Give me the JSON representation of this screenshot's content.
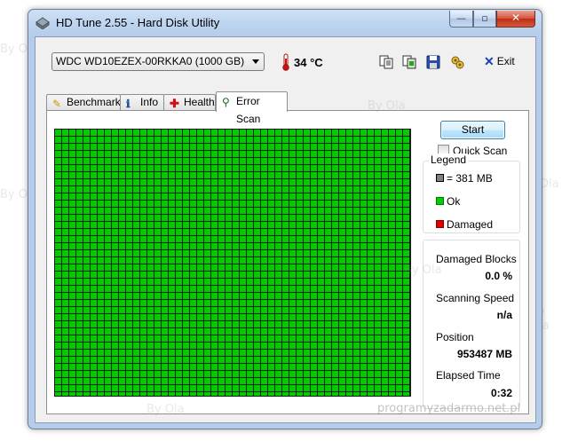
{
  "window": {
    "title": "HD Tune 2.55 - Hard Disk Utility",
    "controls": {
      "minimize": "—",
      "maximize": "▫",
      "close": "✕"
    }
  },
  "toolbar": {
    "drive": "WDC WD10EZEX-00RKKA0 (1000 GB)",
    "temperature": "34 °C",
    "icons": [
      "copy-text-icon",
      "copy-screenshot-icon",
      "save-icon",
      "options-icon"
    ],
    "exit_label": "Exit"
  },
  "tabs": [
    {
      "label": "Benchmark",
      "icon": "benchmark-icon"
    },
    {
      "label": "Info",
      "icon": "info-icon"
    },
    {
      "label": "Health",
      "icon": "health-icon"
    },
    {
      "label": "Error Scan",
      "icon": "error-scan-icon",
      "active": true
    }
  ],
  "error_scan": {
    "start_label": "Start",
    "quick_scan_label": "Quick Scan",
    "quick_scan_checked": false,
    "legend": {
      "title": "Legend",
      "block_size": "= 381 MB",
      "ok": "Ok",
      "damaged": "Damaged"
    },
    "stats": {
      "damaged_blocks_label": "Damaged Blocks",
      "damaged_blocks_value": "0.0 %",
      "scanning_speed_label": "Scanning Speed",
      "scanning_speed_value": "n/a",
      "position_label": "Position",
      "position_value": "953487 MB",
      "elapsed_label": "Elapsed Time",
      "elapsed_value": "0:32"
    }
  },
  "colors": {
    "ok": "#00cc00",
    "damaged": "#e00000",
    "block": "#808080",
    "grid_line": "#1a1a1a"
  },
  "watermark": {
    "author": "By Ola",
    "site": "programyzadarmo.net.pl"
  }
}
